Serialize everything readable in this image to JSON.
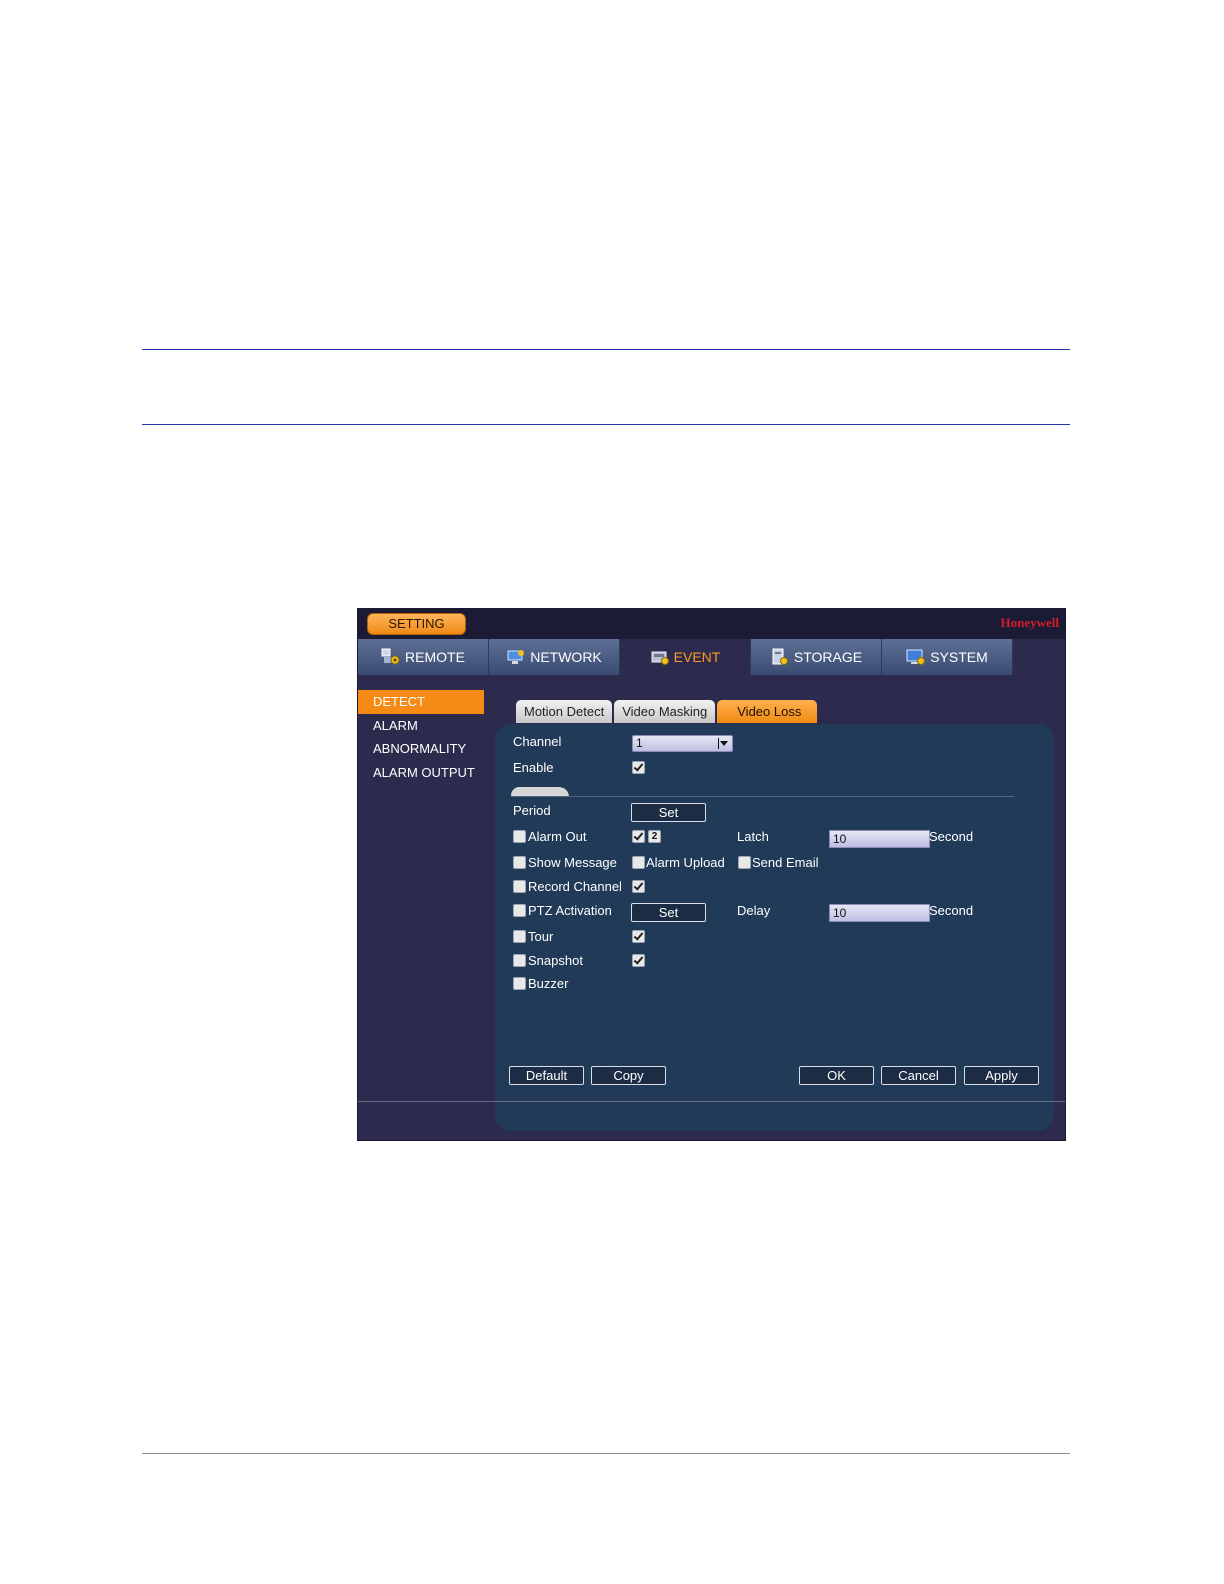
{
  "window": {
    "setting_label": "SETTING",
    "brand": "Honeywell"
  },
  "topnav": [
    {
      "label": "REMOTE",
      "icon": "remote-gear-icon"
    },
    {
      "label": "NETWORK",
      "icon": "network-icon"
    },
    {
      "label": "EVENT",
      "icon": "event-icon"
    },
    {
      "label": "STORAGE",
      "icon": "storage-icon"
    },
    {
      "label": "SYSTEM",
      "icon": "system-icon"
    }
  ],
  "leftmenu": [
    "DETECT",
    "ALARM",
    "ABNORMALITY",
    "ALARM OUTPUT"
  ],
  "subtabs": [
    "Motion Detect",
    "Video Masking",
    "Video Loss"
  ],
  "form": {
    "channel_label": "Channel",
    "channel_value": "1",
    "enable_label": "Enable",
    "period_label": "Period",
    "set_label": "Set",
    "alarm_out_label": "Alarm Out",
    "alarm_out_channel": "2",
    "latch_label": "Latch",
    "latch_value": "10",
    "second_label": "Second",
    "show_message_label": "Show Message",
    "alarm_upload_label": "Alarm Upload",
    "send_email_label": "Send Email",
    "record_channel_label": "Record Channel",
    "ptz_activation_label": "PTZ Activation",
    "delay_label": "Delay",
    "delay_value": "10",
    "tour_label": "Tour",
    "snapshot_label": "Snapshot",
    "buzzer_label": "Buzzer"
  },
  "buttons": {
    "default": "Default",
    "copy": "Copy",
    "ok": "OK",
    "cancel": "Cancel",
    "apply": "Apply"
  },
  "colors": {
    "accent": "#f58a14",
    "panel": "#213a57",
    "window_bg": "#2c2a4d",
    "brand": "#d21e28"
  }
}
